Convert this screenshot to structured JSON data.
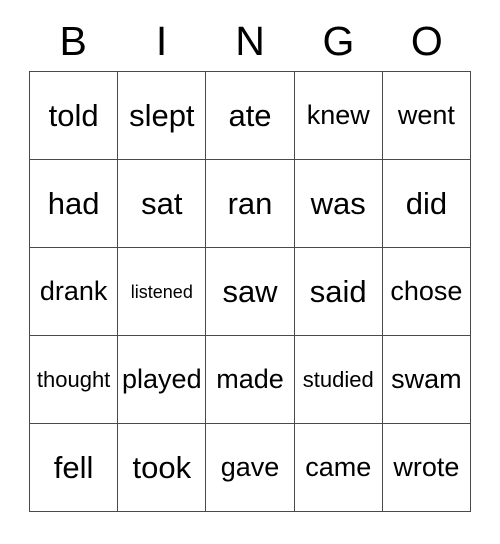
{
  "card": {
    "title": "BINGO",
    "header_letters": [
      "B",
      "I",
      "N",
      "G",
      "O"
    ],
    "colors": {
      "background": "#ffffff",
      "text": "#000000",
      "border": "#4a4a4a"
    },
    "grid": {
      "columns": 5,
      "rows": 5,
      "cells": [
        [
          {
            "text": "told",
            "size": "lg"
          },
          {
            "text": "slept",
            "size": "lg"
          },
          {
            "text": "ate",
            "size": "lg"
          },
          {
            "text": "knew",
            "size": "md"
          },
          {
            "text": "went",
            "size": "md"
          }
        ],
        [
          {
            "text": "had",
            "size": "lg"
          },
          {
            "text": "sat",
            "size": "lg"
          },
          {
            "text": "ran",
            "size": "lg"
          },
          {
            "text": "was",
            "size": "lg"
          },
          {
            "text": "did",
            "size": "lg"
          }
        ],
        [
          {
            "text": "drank",
            "size": "md"
          },
          {
            "text": "listened",
            "size": "xs"
          },
          {
            "text": "saw",
            "size": "lg"
          },
          {
            "text": "said",
            "size": "lg"
          },
          {
            "text": "chose",
            "size": "md"
          }
        ],
        [
          {
            "text": "thought",
            "size": "sm"
          },
          {
            "text": "played",
            "size": "md"
          },
          {
            "text": "made",
            "size": "md"
          },
          {
            "text": "studied",
            "size": "sm"
          },
          {
            "text": "swam",
            "size": "md"
          }
        ],
        [
          {
            "text": "fell",
            "size": "lg"
          },
          {
            "text": "took",
            "size": "lg"
          },
          {
            "text": "gave",
            "size": "md"
          },
          {
            "text": "came",
            "size": "md"
          },
          {
            "text": "wrote",
            "size": "md"
          }
        ]
      ]
    }
  }
}
